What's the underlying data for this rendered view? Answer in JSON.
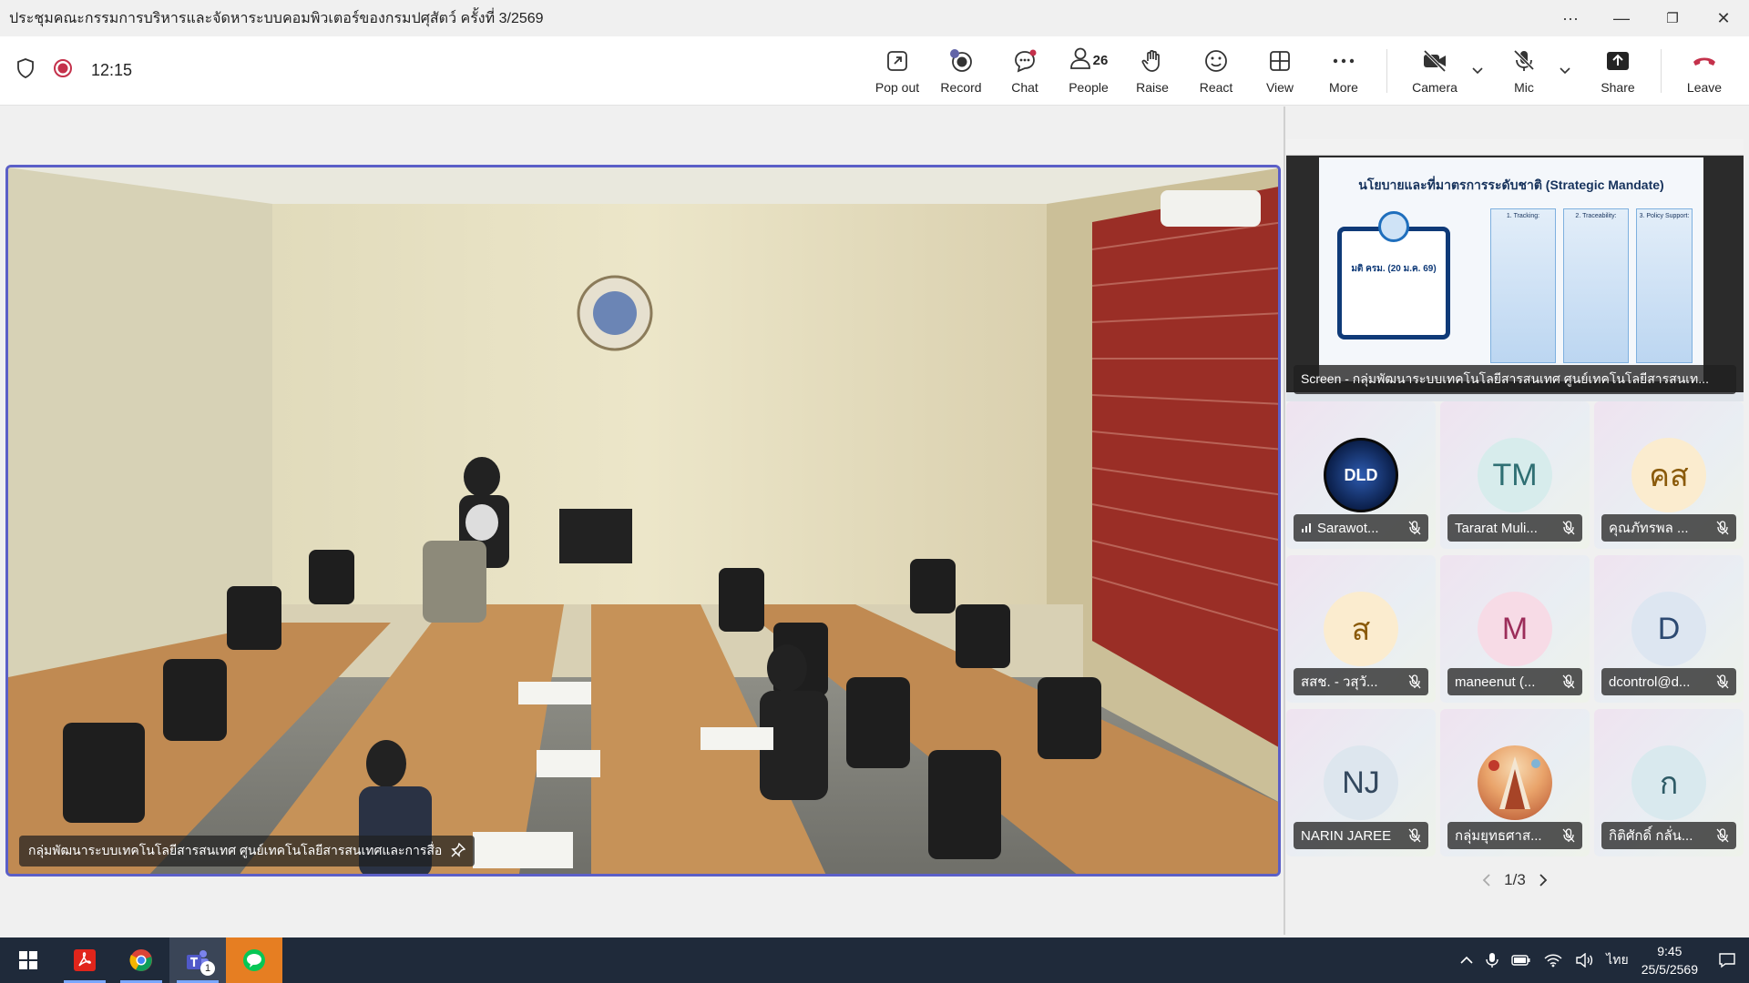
{
  "window": {
    "title": "ประชุมคณะกรรมการบริหารและจัดหาระบบคอมพิวเตอร์ของกรมปศุสัตว์ ครั้งที่ 3/2569",
    "more_label": "···",
    "minimize": "—",
    "maximize": "❐",
    "close": "✕"
  },
  "toolbar": {
    "timer": "12:15",
    "pop_out": "Pop out",
    "record": "Record",
    "chat": "Chat",
    "people": "People",
    "people_count": "26",
    "raise": "Raise",
    "react": "React",
    "view": "View",
    "more": "More",
    "camera": "Camera",
    "mic": "Mic",
    "share": "Share",
    "leave": "Leave"
  },
  "main_video": {
    "name": "กลุ่มพัฒนาระบบเทคโนโลยีสารสนเทศ ศูนย์เทคโนโลยีสารสนเทศและการสื่อ"
  },
  "screen_share": {
    "name": "Screen - กลุ่มพัฒนาระบบเทคโนโลยีสารสนเทศ ศูนย์เทคโนโลยีสารสนเท...",
    "slide_title": "นโยบายและที่มาตรการระดับชาติ (Strategic Mandate)",
    "slide_box": "มติ ครม. (20 ม.ค. 69)",
    "pillar_1": "1. Tracking:",
    "pillar_2": "2. Traceability:",
    "pillar_3": "3. Policy Support:"
  },
  "participants": [
    {
      "name": "Sarawot...",
      "initials": "DLD",
      "avatar_type": "logo",
      "color": "#1d3b7a"
    },
    {
      "name": "Tararat Muli...",
      "initials": "TM",
      "avatar_type": "initials",
      "color": "#d7ecec",
      "text_color": "#2f6f73"
    },
    {
      "name": "คุณภัทรพล ...",
      "initials": "คส",
      "avatar_type": "initials",
      "color": "#fbeccf",
      "text_color": "#8a5a0a"
    },
    {
      "name": "สสช. - วสุวั...",
      "initials": "ส",
      "avatar_type": "initials",
      "color": "#fbeccf",
      "text_color": "#8a5a0a"
    },
    {
      "name": "maneenut (...",
      "initials": "M",
      "avatar_type": "initials",
      "color": "#f7dbe6",
      "text_color": "#9c2d5a"
    },
    {
      "name": "dcontrol@d...",
      "initials": "D",
      "avatar_type": "initials",
      "color": "#dde6f1",
      "text_color": "#2d4a72"
    },
    {
      "name": "NARIN JAREE",
      "initials": "NJ",
      "avatar_type": "initials",
      "color": "#dde6ee",
      "text_color": "#33485e"
    },
    {
      "name": "กลุ่มยุทธศาส...",
      "initials": "",
      "avatar_type": "photo",
      "color": "#e9a36a"
    },
    {
      "name": "กิติศักดิ์ กลั่น...",
      "initials": "ก",
      "avatar_type": "initials",
      "color": "#d9e9ee",
      "text_color": "#2e5b66"
    }
  ],
  "pager": {
    "label": "1/3"
  },
  "taskbar": {
    "lang": "ไทย",
    "time": "9:45",
    "date": "25/5/2569",
    "teams_badge": "1"
  }
}
